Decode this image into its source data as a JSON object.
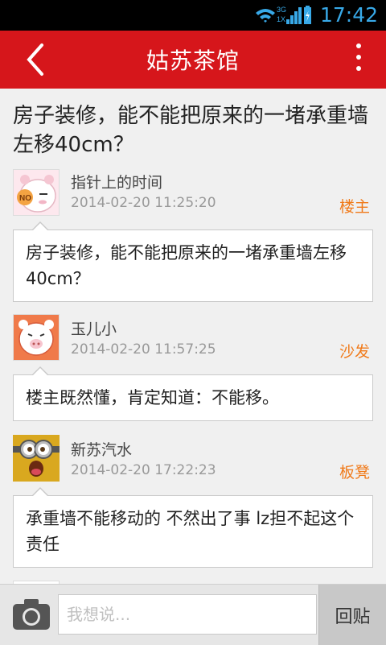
{
  "status_bar": {
    "time": "17:42",
    "network_labels": [
      "3G",
      "1X"
    ]
  },
  "app_bar": {
    "title": "姑苏茶馆"
  },
  "thread": {
    "title": "房子装修，能不能把原来的一堵承重墙左移40cm？"
  },
  "posts": [
    {
      "username": "指针上的时间",
      "time": "2014-02-20 11:25:20",
      "floor": "楼主",
      "content": "房子装修，能不能把原来的一堵承重墙左移40cm？"
    },
    {
      "username": "玉儿小",
      "time": "2014-02-20 11:57:25",
      "floor": "沙发",
      "content": "楼主既然懂，肯定知道：不能移。"
    },
    {
      "username": "新苏汽水",
      "time": "2014-02-20 17:22:23",
      "floor": "板凳",
      "content": "承重墙不能移动的  不然出了事  lz担不起这个责任"
    }
  ],
  "reply_bar": {
    "placeholder": "我想说...",
    "value": "",
    "submit_label": "回贴"
  },
  "colors": {
    "header": "#d6161b",
    "floor_label": "#f07a1a",
    "status_accent": "#38a9e8"
  }
}
